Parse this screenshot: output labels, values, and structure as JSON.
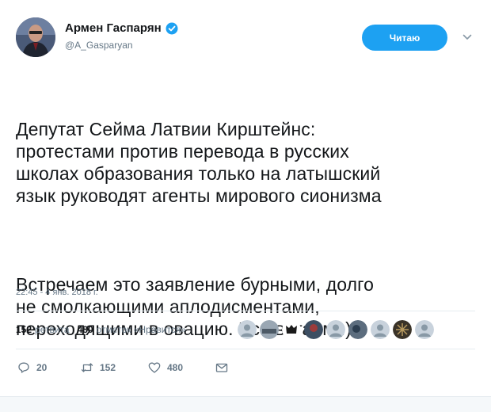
{
  "author": {
    "display_name": "Армен Гаспарян",
    "handle": "@A_Gasparyan",
    "verified": true
  },
  "follow_button": {
    "label": "Читаю"
  },
  "tweet": {
    "paragraphs": [
      "Депутат Сейма Латвии Кирштейнс:\nпротестами против перевода в русских\nшколах образования только на латышский\nязык руководят агенты мирового сионизма",
      "Встречаем это заявление бурными, долго\nне смолкающими аплодисментами,\nпереходящими в овацию. Все встаем :)"
    ],
    "timestamp": "22:45 - 4 янв. 2018 г."
  },
  "stats": {
    "retweets_count": "152",
    "retweets_label": "ретвита",
    "likes_count": "480",
    "likes_label": "отметок «Нравится»"
  },
  "actions": {
    "reply_count": "20",
    "retweet_count": "152",
    "like_count": "480"
  },
  "colors": {
    "accent": "#1da1f2",
    "muted_text": "#657786",
    "text": "#14171a"
  },
  "icons": [
    "verified-badge-icon",
    "chevron-down-icon",
    "reply-icon",
    "retweet-icon",
    "heart-icon",
    "envelope-icon"
  ]
}
